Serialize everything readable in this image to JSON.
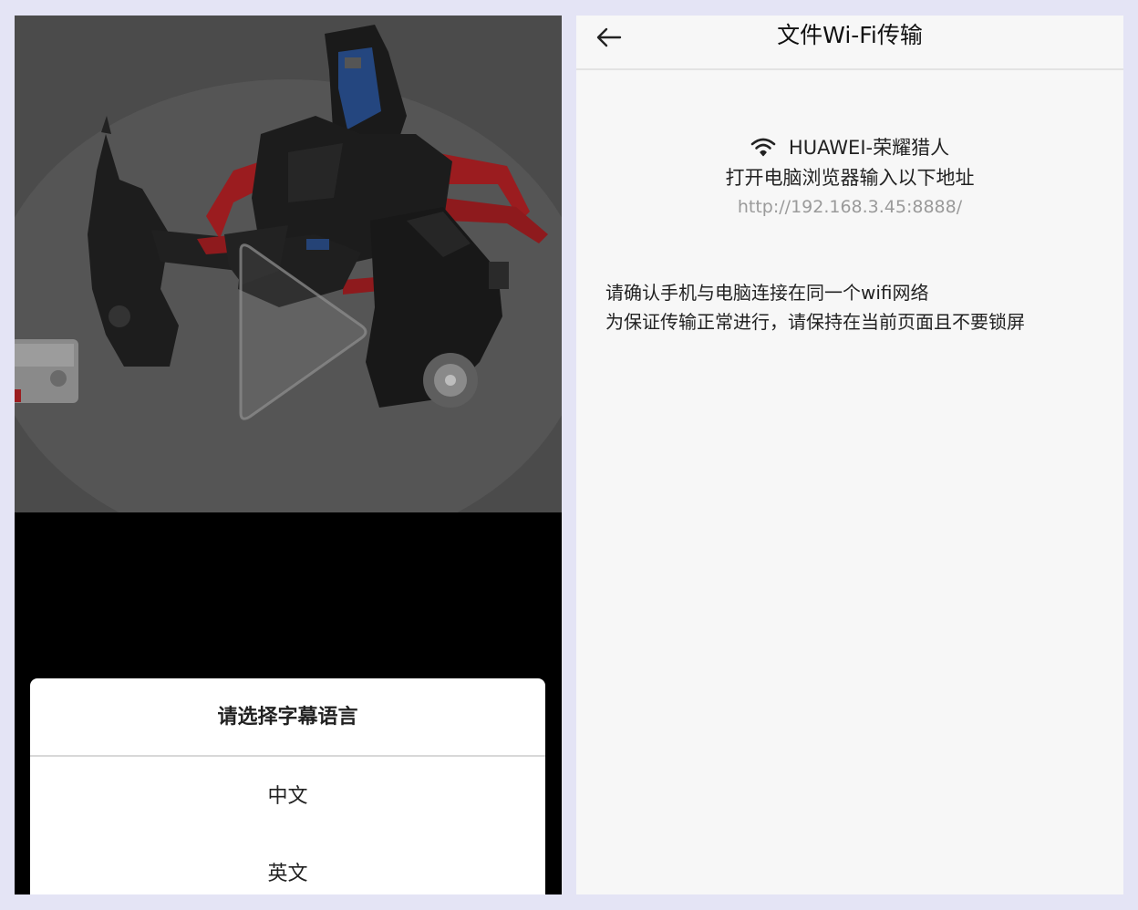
{
  "left_screen": {
    "video": {
      "icon": "play-icon"
    },
    "subtitle_dialog": {
      "title": "请选择字幕语言",
      "options": [
        {
          "label": "中文"
        },
        {
          "label": "英文"
        }
      ]
    }
  },
  "right_screen": {
    "header": {
      "back_icon": "back-arrow-icon",
      "title": "文件Wi-Fi传输"
    },
    "network": {
      "icon": "wifi-icon",
      "name": "HUAWEI-荣耀猎人"
    },
    "instruction": "打开电脑浏览器输入以下地址",
    "address": "http://192.168.3.45:8888/",
    "notes": [
      "请确认手机与电脑连接在同一个wifi网络",
      "为保证传输正常进行，请保持在当前页面且不要锁屏"
    ]
  },
  "colors": {
    "page_background": "#e4e4f5",
    "video_overlay": "#4a4a4a",
    "panel_background": "#f7f7f7",
    "address_text": "#9a9a9a",
    "robot_accent_red": "#c0262a",
    "robot_accent_blue": "#2a5bb0"
  }
}
